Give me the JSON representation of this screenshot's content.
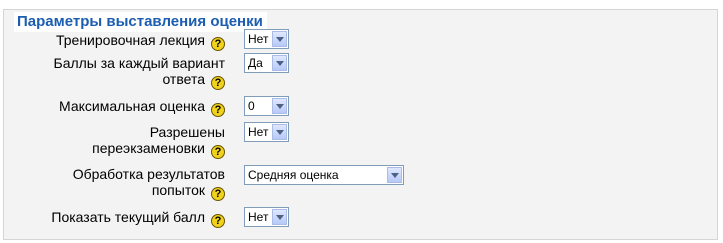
{
  "section": {
    "legend": "Параметры выставления оценки",
    "rows": [
      {
        "label_lines": [
          "Тренировочная лекция"
        ],
        "help_icon": "?",
        "select_value": "Нет"
      },
      {
        "label_lines": [
          "Баллы за каждый вариант",
          "ответа"
        ],
        "help_icon": "?",
        "select_value": "Да"
      },
      {
        "label_lines": [
          "Максимальная оценка"
        ],
        "help_icon": "?",
        "select_value": "0"
      },
      {
        "label_lines": [
          "Разрешены",
          "переэкзаменовки"
        ],
        "help_icon": "?",
        "select_value": "Нет"
      },
      {
        "label_lines": [
          "Обработка результатов",
          "попыток"
        ],
        "help_icon": "?",
        "select_value": "Средняя оценка"
      },
      {
        "label_lines": [
          "Показать текущий балл"
        ],
        "help_icon": "?",
        "select_value": "Нет"
      }
    ]
  },
  "colors": {
    "legend_text": "#1b5db0",
    "panel_bg": "#f3f3f3",
    "help_icon_fill": "#f0d21c"
  }
}
